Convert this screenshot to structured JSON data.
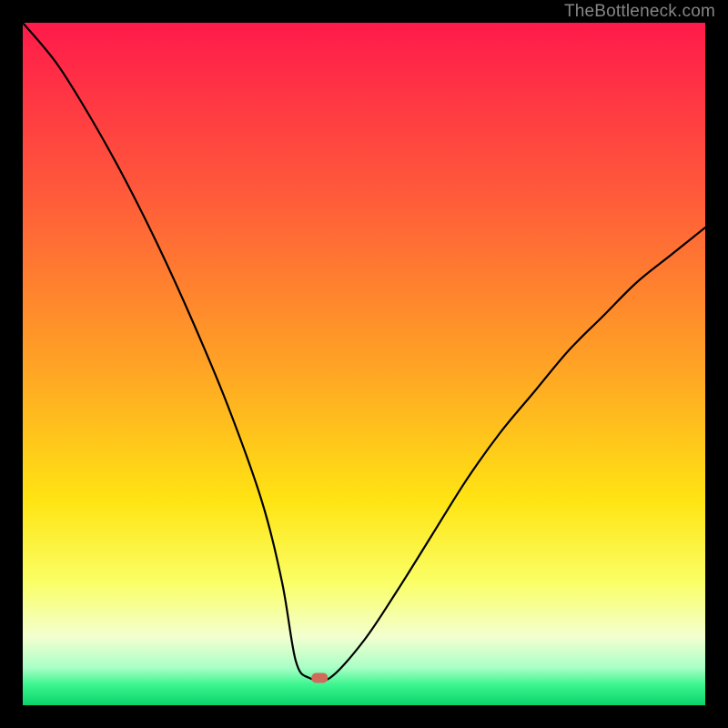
{
  "watermark": "TheBottleneck.com",
  "chart_data": {
    "type": "line",
    "title": "",
    "xlabel": "",
    "ylabel": "",
    "xlim": [
      0,
      100
    ],
    "ylim": [
      0,
      100
    ],
    "series": [
      {
        "name": "curve",
        "x": [
          0,
          5,
          10,
          15,
          20,
          25,
          30,
          35,
          38,
          40,
          42,
          45,
          50,
          55,
          60,
          65,
          70,
          75,
          80,
          85,
          90,
          95,
          100
        ],
        "values": [
          100,
          94,
          86,
          77,
          67,
          56,
          44,
          30,
          18,
          6.5,
          4.0,
          4.0,
          9.5,
          17,
          25,
          33,
          40,
          46,
          52,
          57,
          62,
          66,
          70
        ]
      }
    ],
    "minimum_marker": {
      "x": 43.5,
      "y": 4.0
    },
    "gradient_stops": [
      {
        "offset": 0.0,
        "color": "#ff1a4b"
      },
      {
        "offset": 0.25,
        "color": "#ff5a3a"
      },
      {
        "offset": 0.5,
        "color": "#ffa225"
      },
      {
        "offset": 0.7,
        "color": "#ffe413"
      },
      {
        "offset": 0.82,
        "color": "#faff66"
      },
      {
        "offset": 0.9,
        "color": "#f3ffd0"
      },
      {
        "offset": 0.945,
        "color": "#a9ffc6"
      },
      {
        "offset": 0.97,
        "color": "#3cf58e"
      },
      {
        "offset": 1.0,
        "color": "#0bd36c"
      }
    ],
    "marker_color": "#d06a5b",
    "curve_color": "#000000",
    "curve_width": 2.2
  }
}
